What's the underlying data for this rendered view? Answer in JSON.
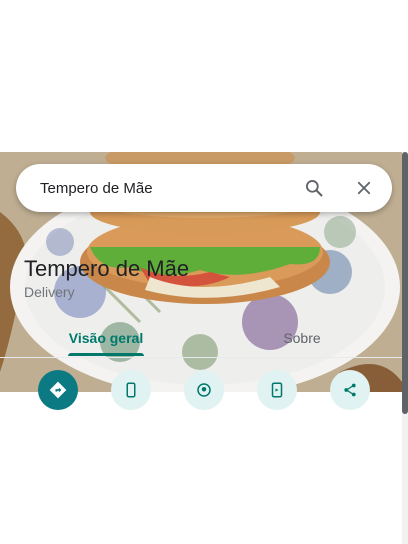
{
  "search": {
    "query": "Tempero de Mãe"
  },
  "place": {
    "name": "Tempero de Mãe",
    "category": "Delivery"
  },
  "tabs": [
    {
      "label": "Visão geral",
      "active": true
    },
    {
      "label": "Sobre",
      "active": false
    }
  ],
  "actions": [
    {
      "icon": "directions-icon"
    },
    {
      "icon": "phone-icon"
    },
    {
      "icon": "nearby-icon"
    },
    {
      "icon": "send-to-phone-icon"
    },
    {
      "icon": "share-icon"
    }
  ],
  "colors": {
    "accent": "#00796b",
    "action_primary": "#0b7a83",
    "action_secondary": "#e0f2f1",
    "title": "#202124",
    "muted": "#70757a"
  }
}
